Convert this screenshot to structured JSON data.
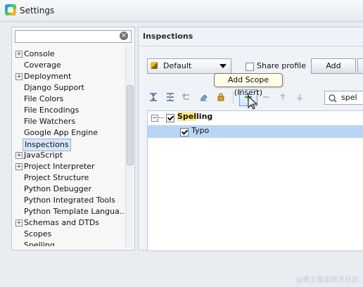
{
  "window": {
    "title": "Settings",
    "app_icon": "pycharm-icon"
  },
  "left_panel": {
    "search": {
      "value": "",
      "placeholder": ""
    },
    "items": [
      {
        "label": "Console",
        "expandable": true
      },
      {
        "label": "Coverage",
        "expandable": false
      },
      {
        "label": "Deployment",
        "expandable": true
      },
      {
        "label": "Django Support",
        "expandable": false
      },
      {
        "label": "File Colors",
        "expandable": false
      },
      {
        "label": "File Encodings",
        "expandable": false
      },
      {
        "label": "File Watchers",
        "expandable": false
      },
      {
        "label": "Google App Engine",
        "expandable": false
      },
      {
        "label": "Inspections",
        "expandable": false,
        "selected": true
      },
      {
        "label": "JavaScript",
        "expandable": true
      },
      {
        "label": "Project Interpreter",
        "expandable": true
      },
      {
        "label": "Project Structure",
        "expandable": false
      },
      {
        "label": "Python Debugger",
        "expandable": false
      },
      {
        "label": "Python Integrated Tools",
        "expandable": false
      },
      {
        "label": "Python Template Langua...",
        "expandable": false
      },
      {
        "label": "Schemas and DTDs",
        "expandable": true
      },
      {
        "label": "Scopes",
        "expandable": false
      },
      {
        "label": "Spelling",
        "expandable": false
      }
    ]
  },
  "right_panel": {
    "heading": "Inspections",
    "profile": "Default",
    "share_profile": {
      "label": "Share profile",
      "checked": false
    },
    "add_button": "Add",
    "tooltip": "Add Scope (Insert)",
    "filter": {
      "value": "spel"
    },
    "tree": {
      "spelling": {
        "label_prefix": "Spel",
        "label_suffix": "ling",
        "checked": true,
        "expanded": true
      },
      "typo": {
        "label": "Typo",
        "checked": true,
        "selected": true
      }
    }
  },
  "watermark": "@稀土掘金技术社区",
  "colors": {
    "selection": "#b9d5f5",
    "highlight": "#ffe98a",
    "tooltip_bg": "#fffce8"
  }
}
